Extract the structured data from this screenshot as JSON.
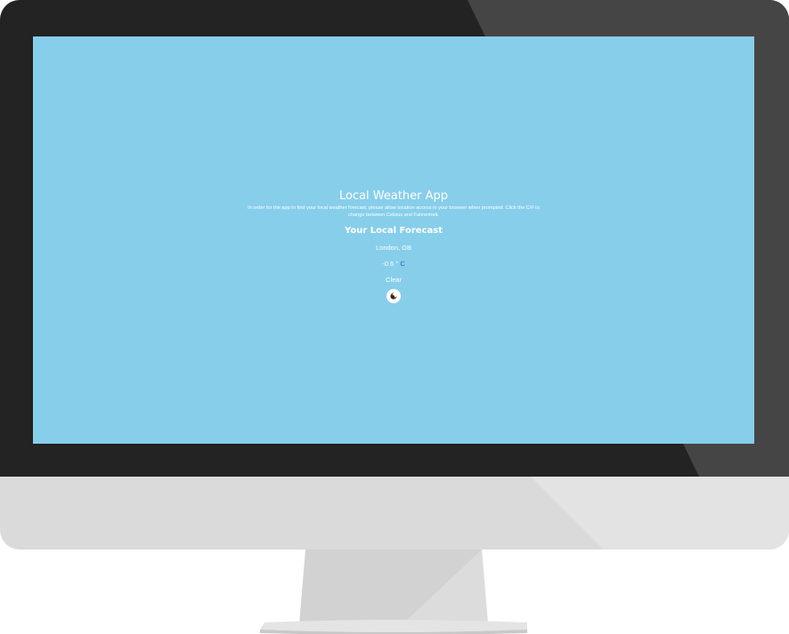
{
  "app": {
    "title": "Local Weather App",
    "instructions": "In order for the app to find your local weather forecast, please allow location access in your browser when prompted. Click the C/F to change between Celsius and Fahrenheit.",
    "forecast_heading": "Your Local Forecast",
    "location": "London, GB",
    "temperature_value": "-0.6",
    "temperature_degree": "°",
    "temperature_unit": "C",
    "condition": "Clear",
    "condition_icon": "moon-clear-night-icon"
  },
  "colors": {
    "screen_background": "#87ceeb",
    "text": "#ffffff",
    "unit_link": "#2b5fa8",
    "bezel": "#232323",
    "chin": "#dadada"
  }
}
